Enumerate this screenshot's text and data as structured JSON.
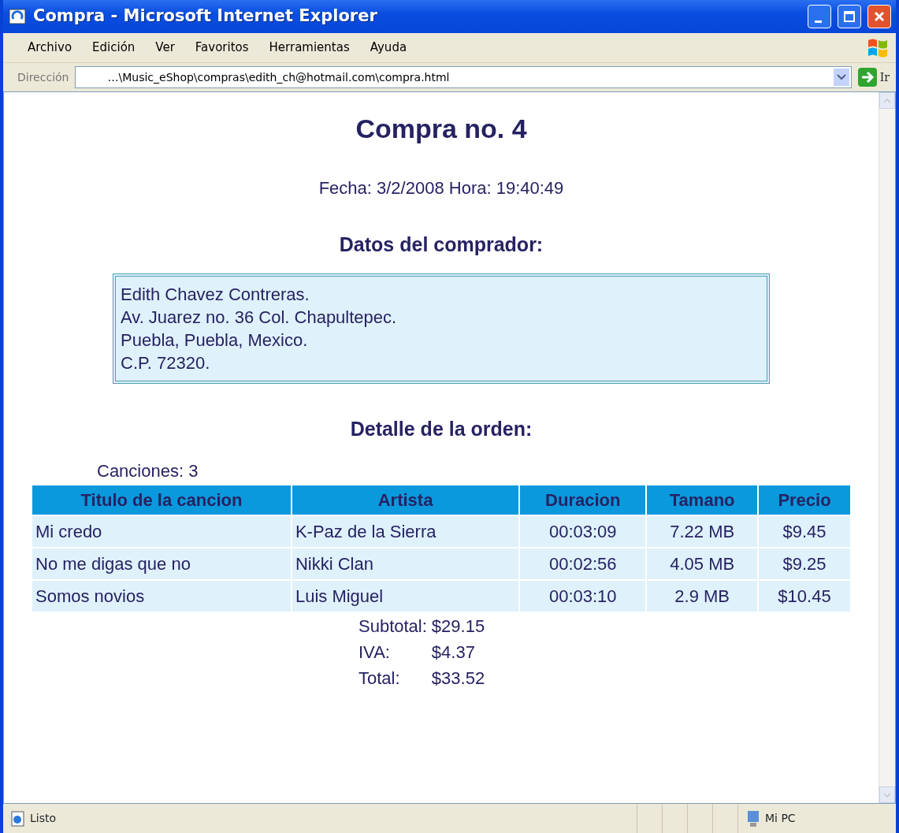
{
  "window": {
    "title": "Compra - Microsoft Internet Explorer"
  },
  "menu": [
    "Archivo",
    "Edición",
    "Ver",
    "Favoritos",
    "Herramientas",
    "Ayuda"
  ],
  "address_bar": {
    "label": "Dirección",
    "value": "…\\Music_eShop\\compras\\edith_ch@hotmail.com\\compra.html",
    "go": "Ir"
  },
  "page": {
    "heading": "Compra no. 4",
    "datetime": "Fecha: 3/2/2008 Hora: 19:40:49",
    "buyer_heading": "Datos del comprador:",
    "buyer_lines": [
      "Edith Chavez Contreras.",
      "Av. Juarez no. 36 Col. Chapultepec.",
      "Puebla, Puebla, Mexico.",
      "C.P. 72320."
    ],
    "order_heading": "Detalle de la orden:",
    "songs_count": "Canciones: 3",
    "table": {
      "columns": [
        "Titulo de la cancion",
        "Artista",
        "Duracion",
        "Tamano",
        "Precio"
      ],
      "rows": [
        [
          "Mi credo",
          "K-Paz de la Sierra",
          "00:03:09",
          "7.22 MB",
          "$9.45"
        ],
        [
          "No me digas que no",
          "Nikki Clan",
          "00:02:56",
          "4.05 MB",
          "$9.25"
        ],
        [
          "Somos novios",
          "Luis Miguel",
          "00:03:10",
          "2.9 MB",
          "$10.45"
        ]
      ]
    },
    "totals": [
      {
        "label": "Subtotal:",
        "value": "$29.15"
      },
      {
        "label": "IVA:",
        "value": "$4.37"
      },
      {
        "label": "Total:",
        "value": "$33.52"
      }
    ]
  },
  "status_bar": {
    "text": "Listo",
    "zone": "Mi PC"
  }
}
